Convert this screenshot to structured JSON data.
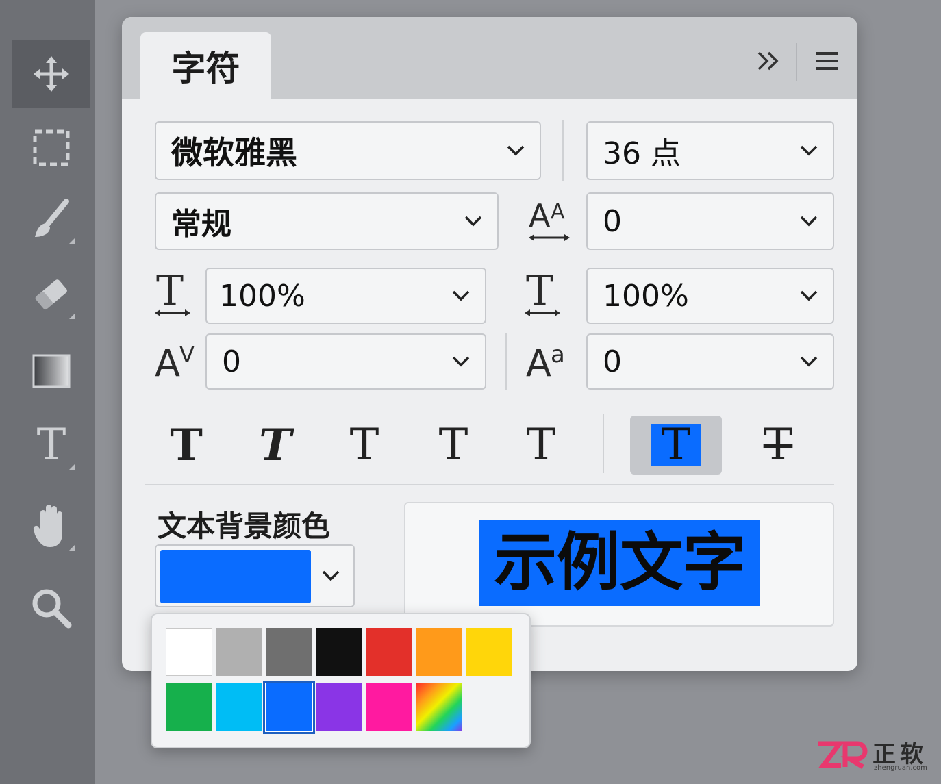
{
  "toolbar": {
    "tools": [
      {
        "name": "move-tool",
        "icon": "move-icon"
      },
      {
        "name": "marquee-tool",
        "icon": "marquee-icon"
      },
      {
        "name": "brush-tool",
        "icon": "brush-icon"
      },
      {
        "name": "eraser-tool",
        "icon": "eraser-icon"
      },
      {
        "name": "gradient-tool",
        "icon": "gradient-icon"
      },
      {
        "name": "type-tool",
        "icon": "type-icon",
        "glyph": "T"
      },
      {
        "name": "hand-tool",
        "icon": "hand-icon"
      },
      {
        "name": "zoom-tool",
        "icon": "zoom-icon"
      }
    ]
  },
  "panel": {
    "tab_title": "字符",
    "collapse_icon": "double-chevron-right-icon",
    "menu_icon": "hamburger-menu-icon"
  },
  "font": {
    "family": "微软雅黑",
    "size": "36 点",
    "style": "常规",
    "leading": "0",
    "vertical_scale": "100%",
    "horizontal_scale": "100%",
    "kerning": "0",
    "baseline_shift": "0"
  },
  "icons": {
    "leading": "leading-icon",
    "vertical_scale": "vertical-scale-icon",
    "horizontal_scale": "horizontal-scale-icon",
    "kerning": "kerning-icon",
    "baseline_shift": "baseline-shift-icon"
  },
  "glyphs": {
    "leading_a": "A",
    "leading_b": "A",
    "kerning_a": "A",
    "kerning_b": "V",
    "baseline_a": "A",
    "baseline_b": "a",
    "scale_t": "T"
  },
  "style_buttons": [
    {
      "name": "faux-bold-button",
      "label": "T"
    },
    {
      "name": "faux-italic-button",
      "label": "T"
    },
    {
      "name": "all-caps-button",
      "label": "T"
    },
    {
      "name": "small-caps-button",
      "label": "T"
    },
    {
      "name": "underline-button",
      "label": "T"
    },
    {
      "name": "text-background-button",
      "label": "T",
      "active": true
    },
    {
      "name": "strikethrough-button",
      "label": "T"
    }
  ],
  "background_color": {
    "label": "文本背景颜色",
    "selected": "#0a6cff"
  },
  "preview": {
    "text": "示例文字"
  },
  "palette": {
    "rows": [
      [
        "#ffffff",
        "#b0b0b0",
        "#6f6f6f",
        "#111111",
        "#e3302a",
        "#ff9a1a",
        "#ffd60a"
      ],
      [
        "#16b04c",
        "#00bdf5",
        "#0a6cff",
        "#8a35e6",
        "#ff1aa0",
        "gradient"
      ]
    ],
    "selected_index": [
      1,
      2
    ]
  },
  "watermark": {
    "zh": "正软",
    "en": "zhengruan.com"
  },
  "colors": {
    "accent": "#0a6cff",
    "panel_bg": "#eeeff1",
    "header_bg": "#c9cbce"
  }
}
